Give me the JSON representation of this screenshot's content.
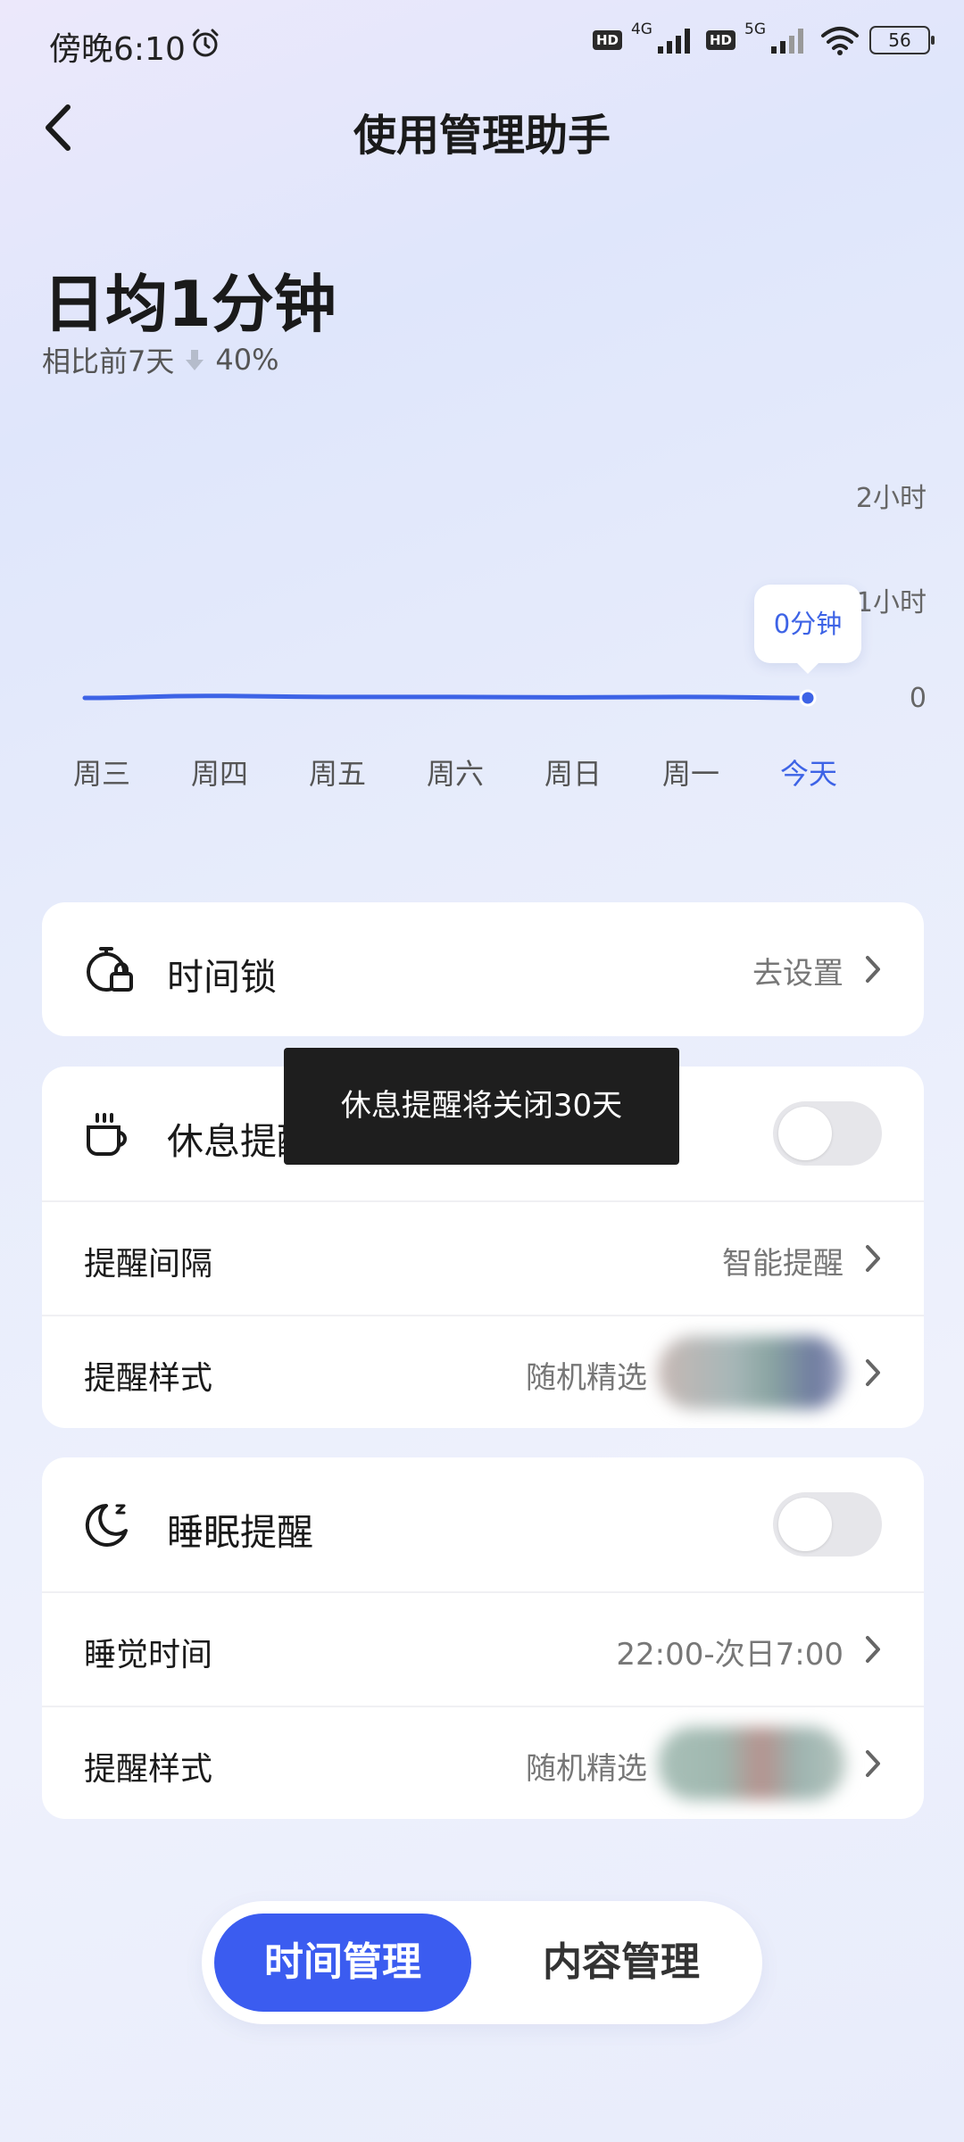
{
  "status_bar": {
    "time": "傍晚6:10",
    "hd1": "HD",
    "net1": "4G",
    "hd2": "HD",
    "net2": "5G",
    "battery": "56"
  },
  "header": {
    "title": "使用管理助手"
  },
  "summary": {
    "title": "日均1分钟",
    "compare_label": "相比前7天",
    "compare_value": "40%"
  },
  "chart_data": {
    "type": "line",
    "categories": [
      "周三",
      "周四",
      "周五",
      "周六",
      "周日",
      "周一",
      "今天"
    ],
    "values": [
      0,
      0.02,
      0.01,
      0.01,
      0.005,
      0.01,
      0
    ],
    "y_tick_labels": [
      "0",
      "1小时",
      "2小时"
    ],
    "ylim": [
      0,
      2
    ],
    "tooltip": "0分钟",
    "highlight_color": "#3d63e6"
  },
  "time_lock": {
    "title": "时间锁",
    "value": "去设置"
  },
  "rest_reminder": {
    "title": "休息提醒",
    "interval_label": "提醒间隔",
    "interval_value": "智能提醒",
    "style_label": "提醒样式",
    "style_value": "随机精选"
  },
  "sleep_reminder": {
    "title": "睡眠提醒",
    "bedtime_label": "睡觉时间",
    "bedtime_value": "22:00-次日7:00",
    "style_label": "提醒样式",
    "style_value": "随机精选"
  },
  "toast": "休息提醒将关闭30天",
  "bottom_tabs": {
    "active": "时间管理",
    "inactive": "内容管理"
  }
}
